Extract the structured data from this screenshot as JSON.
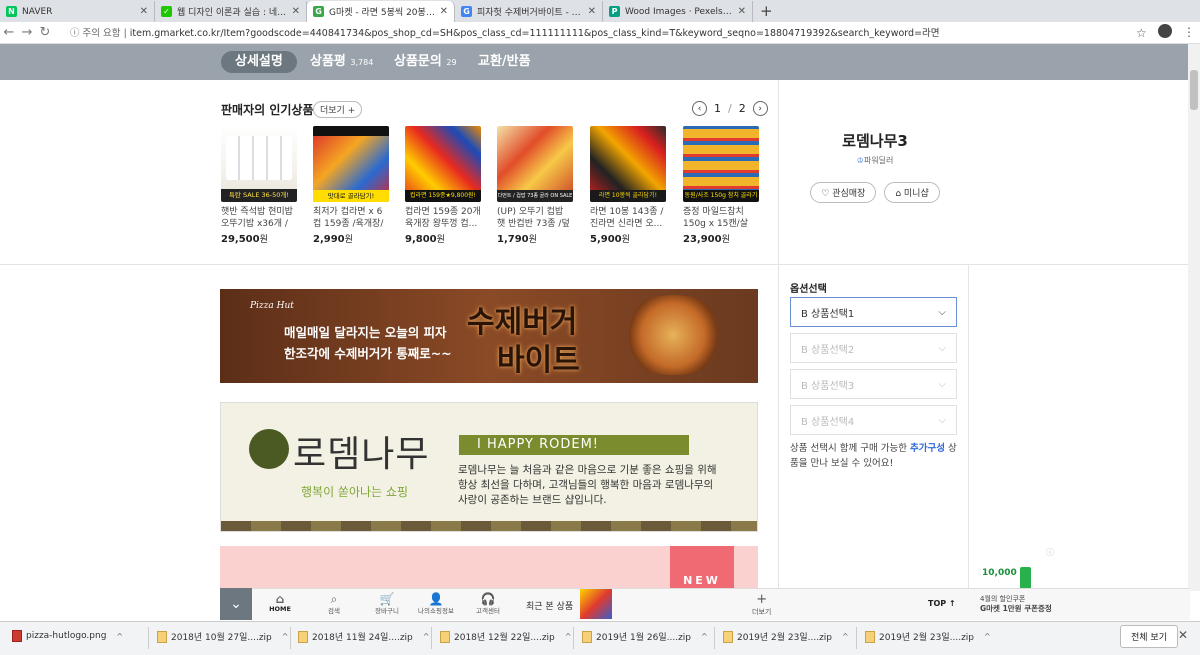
{
  "browser": {
    "tabs": [
      {
        "title": "NAVER",
        "favicon": "N",
        "color": "#03c75a"
      },
      {
        "title": "웹 디자인 이론과 실습 : 네이버",
        "favicon": "✓",
        "color": "#1ec800"
      },
      {
        "title": "G마켓 - 라면 5봉씩 20봉 골라담",
        "favicon": "G",
        "color": "#3aa84a"
      },
      {
        "title": "피자헛 수제버거바이트 - Google",
        "favicon": "G",
        "color": "#4285f4"
      },
      {
        "title": "Wood Images · Pexels · Free Sto",
        "favicon": "P",
        "color": "#05a081"
      }
    ],
    "security_label": "주의 요함",
    "url": "item.gmarket.co.kr/Item?goodscode=440841734&pos_shop_cd=SH&pos_class_cd=111111111&pos_class_kind=T&keyword_seqno=18804719392&search_keyword=라면"
  },
  "site_nav": {
    "tabs": [
      {
        "label": "상세설명",
        "count": ""
      },
      {
        "label": "상품평",
        "count": "3,784"
      },
      {
        "label": "상품문의",
        "count": "29"
      },
      {
        "label": "교환/반품",
        "count": ""
      }
    ]
  },
  "popular": {
    "title": "판매자의 인기상품",
    "more_label": "더보기",
    "page": "1",
    "total_pages": "2",
    "products": [
      {
        "name": "햇반 즉석밥 현미밥 오뚜기밥 x36개 / ...",
        "price": "29,500",
        "img_label": "특탄 SALE 36-50개!"
      },
      {
        "name": "최저가 컵라면 x 6컵 159종 /육개장/컵...",
        "price": "2,990",
        "img_label": "맛대로 골라담기!"
      },
      {
        "name": "컵라면 159종 20개 육개장 왕뚜껑 컵...",
        "price": "9,800",
        "img_label": "컵라면 159종★9,800원!"
      },
      {
        "name": "(UP) 오뚜기 컵밥 햇 반컵반 73종 /덮밥...",
        "price": "1,790",
        "img_label": "다먼트 / 컵밥 73종 골라 ON SALE"
      },
      {
        "name": "라면 10봉 143종 / 진라면 신라면 오...",
        "price": "5,900",
        "img_label": "라면 10봉씩 골라담기!"
      },
      {
        "name": "증정 마일드참치 150g x 15캔/살코...",
        "price": "23,900",
        "img_label": "동원/사조 150g 참치 골라기"
      }
    ],
    "currency_unit": "원"
  },
  "seller": {
    "name": "로뎀나무3",
    "badge": "파워딜러",
    "fav_label": "관심매장",
    "minishop_label": "미니샵"
  },
  "banner1": {
    "brand": "Pizza Hut",
    "line1": "매일매일 달라지는 오늘의 피자",
    "line2": "한조각에 수제버거가 통째로~~",
    "headline1": "수제버거",
    "headline2": "바이트"
  },
  "banner2": {
    "brand": "로뎀나무",
    "tagline": "행복이 쏟아나는 쇼핑",
    "ribbon": "I HAPPY RODEM!",
    "desc1": "로뎀나무는 늘 처음과 같은 마음으로 기분 좋은 쇼핑을 위해",
    "desc2": "항상 최선을 다하며, 고객님들의 행복한 마음과 로뎀나무의",
    "desc3": "사랑이 공존하는 브랜드 샵입니다."
  },
  "banner3": {
    "tag": "NEW"
  },
  "options": {
    "title": "옵션선택",
    "selects": [
      "B 상품선택1",
      "B 상품선택2",
      "B 상품선택3",
      "B 상품선택4"
    ],
    "note_prefix": "상품 선택시 함께 구매 가능한 ",
    "note_link": "추가구성",
    "note_suffix": " 상품을 만나 보실 수 있어요!"
  },
  "coupon": {
    "amount": "10,000",
    "line1": "4월의 할인쿠폰",
    "line2": "G마켓 1만원 쿠폰증정"
  },
  "bottom_nav": {
    "items": [
      {
        "label": "HOME",
        "icon": "⌂"
      },
      {
        "label": "검색",
        "icon": "⌕"
      },
      {
        "label": "장바구니",
        "icon": "🛒"
      },
      {
        "label": "나의쇼핑정보",
        "icon": "👤"
      },
      {
        "label": "고객센터",
        "icon": "🎧"
      }
    ],
    "recent_label": "최근 본 상품",
    "more_label": "더보기",
    "top_label": "TOP ↑"
  },
  "downloads": {
    "files": [
      "pizza-hutlogo.png",
      "2018년 10월 27일....zip",
      "2018년 11월 24일....zip",
      "2018년 12월 22일....zip",
      "2019년 1월 26일....zip",
      "2019년 2월 23일....zip",
      "2019년 2월 23일....zip"
    ],
    "show_all": "전체 보기"
  }
}
